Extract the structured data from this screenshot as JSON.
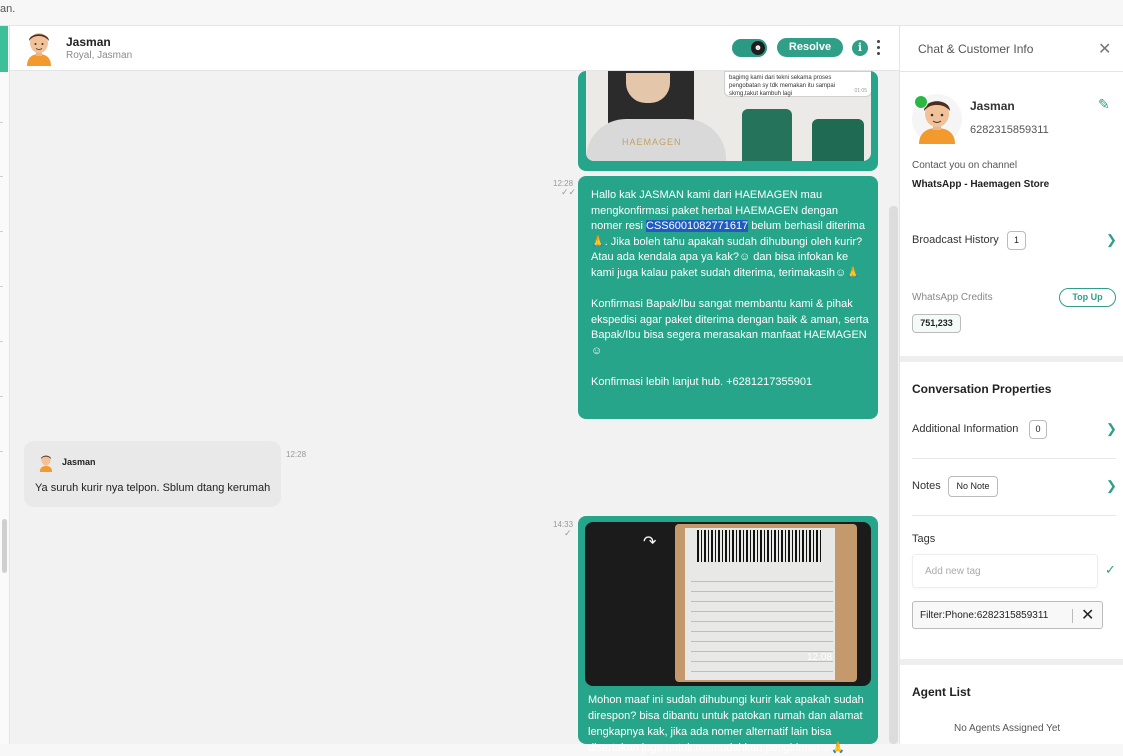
{
  "topbar": {
    "fragment_text": "an."
  },
  "chat_header": {
    "name": "Jasman",
    "subtitle": "Royal, Jasman",
    "resolve_label": "Resolve",
    "info_icon": "i"
  },
  "messages": {
    "image_top": {
      "screenshot_text": "bagimg kami dari tekni sekama proses\npengobatan sy tdk memakan itu sampai\nskmg,takut kambuh lagi",
      "screenshot_time": "01:05",
      "brand_label": "HAEMAGEN"
    },
    "outgoing_1": {
      "time": "12:28",
      "text_before": "Hallo kak JASMAN kami dari HAEMAGEN mau mengkonfirmasi paket herbal HAEMAGEN dengan nomer resi ",
      "highlight": "CSS6001082771617",
      "text_after": " belum berhasil diterima 🙏. Jika boleh tahu apakah sudah dihubungi oleh kurir? Atau ada kendala apa ya kak?☺ dan bisa infokan ke kami juga kalau paket sudah diterima, terimakasih☺🙏\n\nKonfirmasi Bapak/Ibu sangat membantu kami & pihak ekspedisi agar paket diterima dengan baik & aman, serta Bapak/Ibu bisa segera merasakan manfaat HAEMAGEN☺\n\nKonfirmasi lebih lanjut hub. +6281217355901"
    },
    "incoming_1": {
      "sender": "Jasman",
      "time": "12:28",
      "text": "Ya suruh kurir nya telpon. Sblum dtang kerumah"
    },
    "outgoing_2": {
      "time": "14:33",
      "image_time": "12.08",
      "caption": "Mohon maaf ini sudah dihubungi kurir kak apakah sudah direspon? bisa dibantu untuk patokan rumah dan alamat lengkapnya kak, jika ada nomer alternatif lain bisa disertakan juga untuk memudahkan pengiriman☺🙏"
    }
  },
  "panel": {
    "title": "Chat & Customer Info",
    "contact_name": "Jasman",
    "contact_phone": "6282315859311",
    "channel_label": "Contact you on channel",
    "channel_value": "WhatsApp - Haemagen Store",
    "broadcast_label": "Broadcast History",
    "broadcast_count": "1",
    "credits_label": "WhatsApp Credits",
    "topup_label": "Top Up",
    "credits_value": "751,233",
    "conv_props_title": "Conversation Properties",
    "additional_label": "Additional Information",
    "additional_count": "0",
    "notes_label": "Notes",
    "notes_value": "No Note",
    "tags_label": "Tags",
    "tag_placeholder": "Add new tag",
    "tag_chip": "Filter:Phone:6282315859311",
    "agent_list_title": "Agent List",
    "no_agents": "No Agents Assigned Yet"
  },
  "colors": {
    "accent": "#2f9f87",
    "bubble_out": "#27a58a",
    "highlight": "#1f5bc4"
  },
  "icons": [
    "close-icon",
    "pencil-icon",
    "whatsapp-icon",
    "chevron-right-icon",
    "check-icon",
    "forward-icon",
    "kebab-menu-icon",
    "info-icon"
  ]
}
